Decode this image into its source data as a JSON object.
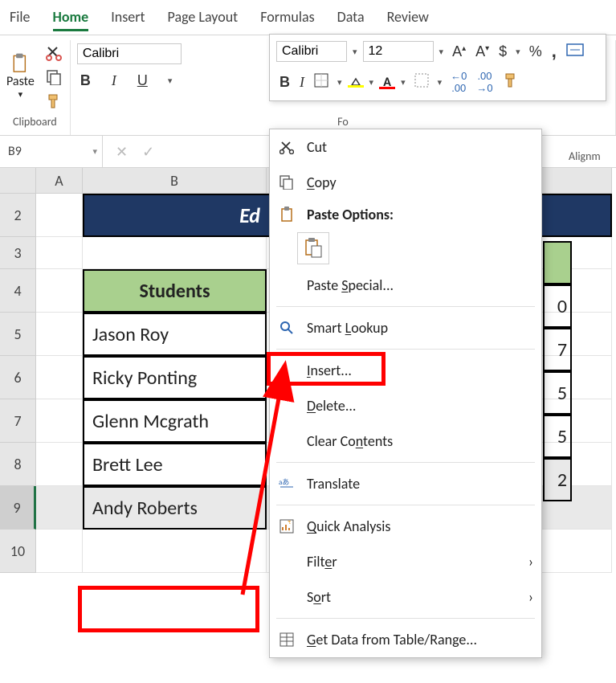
{
  "tabs": [
    "File",
    "Home",
    "Insert",
    "Page Layout",
    "Formulas",
    "Data",
    "Review"
  ],
  "active_tab": 1,
  "ribbon": {
    "clipboard_label": "Clipboard",
    "paste_label": "Paste",
    "font_label": "Fo",
    "alignment_label": "Alignm",
    "font_name": "Calibri",
    "bold": "B",
    "italic": "I",
    "underline": "U"
  },
  "mini_toolbar": {
    "font_name": "Calibri",
    "font_size": "12",
    "bold": "B",
    "italic": "I"
  },
  "name_box": "B9",
  "columns": [
    "A",
    "B"
  ],
  "rows": [
    "2",
    "3",
    "4",
    "5",
    "6",
    "7",
    "8",
    "9",
    "10"
  ],
  "selected_row": "9",
  "title_cell": "Ed",
  "table": {
    "header": "Students",
    "data": [
      "Jason Roy",
      "Ricky Ponting",
      "Glenn Mcgrath",
      "Brett Lee",
      "Andy Roberts"
    ]
  },
  "far_values": [
    "0",
    "7",
    "5",
    "5",
    "2"
  ],
  "context_menu": {
    "cut": "Cut",
    "copy": "Copy",
    "paste_options": "Paste Options:",
    "paste_special": "Paste Special...",
    "smart_lookup": "Smart Lookup",
    "insert": "Insert...",
    "delete": "Delete...",
    "clear": "Clear Contents",
    "translate": "Translate",
    "quick_analysis": "Quick Analysis",
    "filter": "Filter",
    "sort": "Sort",
    "get_data": "Get Data from Table/Range..."
  }
}
